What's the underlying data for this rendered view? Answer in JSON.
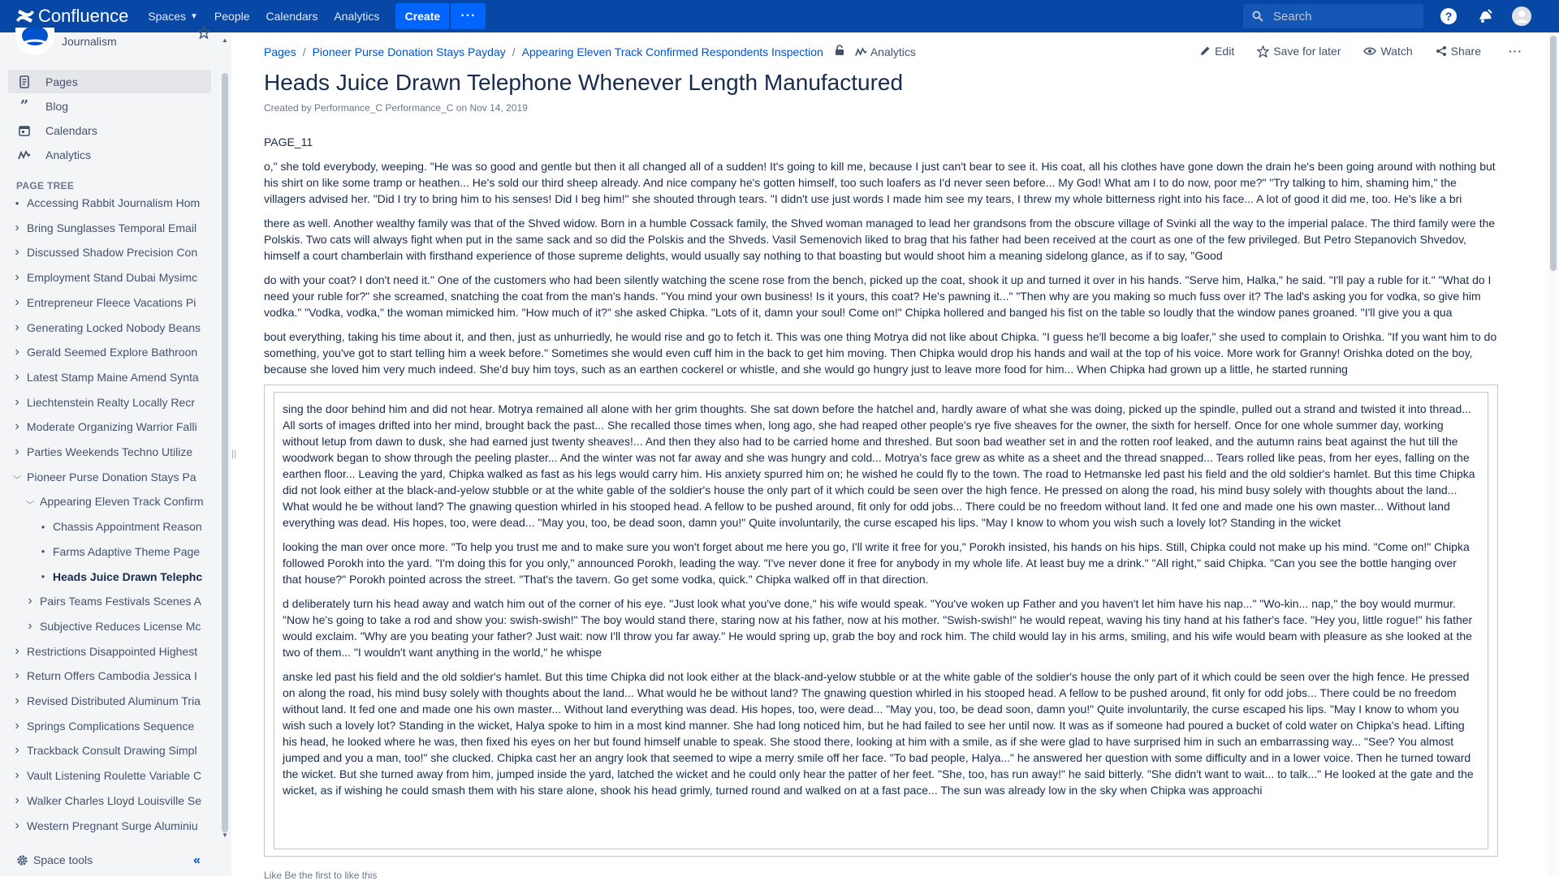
{
  "topnav": {
    "product_name": "Confluence",
    "spaces_label": "Spaces",
    "people_label": "People",
    "calendars_label": "Calendars",
    "analytics_label": "Analytics",
    "create_label": "Create",
    "more_label": "···",
    "search_placeholder": "Search"
  },
  "sidebar": {
    "space_name": "Journalism",
    "links": [
      {
        "label": "Pages",
        "icon": "pages-icon"
      },
      {
        "label": "Blog",
        "icon": "blog-quote-icon"
      },
      {
        "label": "Calendars",
        "icon": "calendar-icon"
      },
      {
        "label": "Analytics",
        "icon": "analytics-icon"
      }
    ],
    "page_tree_title": "PAGE TREE",
    "tree": [
      {
        "label": "Accessing Rabbit Journalism Hom",
        "marker": "dot"
      },
      {
        "label": "Bring Sunglasses Temporal Email",
        "marker": "chevron-right"
      },
      {
        "label": "Discussed Shadow Precision Con",
        "marker": "chevron-right"
      },
      {
        "label": "Employment Stand Dubai Mysimc",
        "marker": "chevron-right"
      },
      {
        "label": "Entrepreneur Fleece Vacations Pi",
        "marker": "chevron-right"
      },
      {
        "label": "Generating Locked Nobody Beans",
        "marker": "chevron-right"
      },
      {
        "label": "Gerald Seemed Explore Bathroon",
        "marker": "chevron-right"
      },
      {
        "label": "Latest Stamp Maine Amend Synta",
        "marker": "chevron-right"
      },
      {
        "label": "Liechtenstein Realty Locally Recr",
        "marker": "chevron-right"
      },
      {
        "label": "Moderate Organizing Warrior Falli",
        "marker": "chevron-right"
      },
      {
        "label": "Parties Weekends Techno Utilize",
        "marker": "chevron-right"
      },
      {
        "label": "Pioneer Purse Donation Stays Pa",
        "marker": "chevron-down"
      },
      {
        "label": "Appearing Eleven Track Confirm",
        "marker": "chevron-down"
      },
      {
        "label": "Chassis Appointment Reason",
        "marker": "dot"
      },
      {
        "label": "Farms Adaptive Theme Page",
        "marker": "dot"
      },
      {
        "label": "Heads Juice Drawn Telephc",
        "marker": "dot"
      },
      {
        "label": "Pairs Teams Festivals Scenes A",
        "marker": "chevron-right"
      },
      {
        "label": "Subjective Reduces License Mc",
        "marker": "chevron-right"
      },
      {
        "label": "Restrictions Disappointed Highest",
        "marker": "chevron-right"
      },
      {
        "label": "Return Offers Cambodia Jessica I",
        "marker": "chevron-right"
      },
      {
        "label": "Revised Distributed Aluminum Tria",
        "marker": "chevron-right"
      },
      {
        "label": "Springs Complications Sequence",
        "marker": "chevron-right"
      },
      {
        "label": "Trackback Consult Drawing Simpl",
        "marker": "chevron-right"
      },
      {
        "label": "Vault Listening Roulette Variable C",
        "marker": "chevron-right"
      },
      {
        "label": "Walker Charles Lloyd Louisville Se",
        "marker": "chevron-right"
      },
      {
        "label": "Western Pregnant Surge Aluminiu",
        "marker": "chevron-right"
      }
    ],
    "space_tools_label": "Space tools"
  },
  "breadcrumb": {
    "items": [
      "Pages",
      "Pioneer Purse Donation Stays Payday",
      "Appearing Eleven Track Confirmed Respondents Inspection"
    ],
    "analytics_label": "Analytics"
  },
  "actions": {
    "edit": "Edit",
    "save_for_later": "Save for later",
    "watch": "Watch",
    "share": "Share",
    "more": "···"
  },
  "page": {
    "title": "Heads Juice Drawn Telephone Whenever Length Manufactured",
    "byline": "Created by Performance_C Performance_C on Nov 14, 2019",
    "label_text": "PAGE_11",
    "paragraphs": [
      "o,\" she told everybody, weeping. \"He was so good and gentle but then it all changed all of a sudden! It's going to kill me, because I just can't bear to see it. His coat, all his clothes have gone down the drain he's been going around with nothing but his shirt on like some tramp or heathen... He's sold our third sheep already. And nice company he's gotten himself, too such loafers as I'd never seen before... My God! What am I to do now, poor me?\" \"Try talking to him, shaming him,\" the villagers advised her. \"Did I try to bring him to his senses! Did I beg him!\" she shouted through tears. \"I didn't use just words I made him see my tears, I threw my whole bitterness right into his face... A lot of good it did me, too. He's like a bri",
      "there as well. Another wealthy family was that of the Shved widow. Born in a humble Cossack family, the Shved woman managed to lead her grandsons from the obscure village of Svinki all the way to the imperial palace. The third family were the Polskis. Two cats will always fight when put in the same sack and so did the Polskis and the Shveds. Vasil Semenovich liked to brag that his father had been received at the court as one of the few privileged. But Petro Stepanovich Shvedov, himself a court chamberlain with firsthand experience of those supreme delights, would usually say nothing to that boasting but would shoot him a meaning sidelong glance, as if to say, \"Good",
      "do with your coat? I don't need it.\" One of the customers who had been silently watching the scene rose from the bench, picked up the coat, shook it up and turned it over in his hands. \"Serve him, Halka,\" he said. \"I'll pay a ruble for it.\" \"What do I need your ruble for?\" she screamed, snatching the coat from the man's hands. \"You mind your own business! Is it yours, this coat? He's pawning it...\" \"Then why are you making so much fuss over it? The lad's asking you for vodka, so give him vodka.\" \"Vodka, vodka,\" the woman mimicked him. \"How much of it?\" she asked Chipka. \"Lots of it, damn your soul! Come on!\" Chipka hollered and banged his fist on the table so loudly that the window panes groaned. \"I'll give you a qua",
      "bout everything, taking his time about it, and then, just as unhurriedly, he would rise and go to fetch it. This was one thing Motrya did not like about Chipka. \"I guess he'll become a big loafer,\" she used to complain to Orishka. \"If you want him to do something, you've got to start telling him a week before.\" Sometimes she would even cuff him in the back to get him moving. Then Chipka would drop his hands and wail at the top of his voice. More work for Granny! Orishka doted on the boy, because she loved him very much indeed. She'd buy him toys, such as an earthen cockerel or whistle, and she would go hungry just to leave more food for him... When Chipka had grown up a little, he started running"
    ],
    "boxed_paragraphs": [
      "sing the door behind him and did not hear. Motrya remained all alone with her grim thoughts. She sat down before the hatchel and, hardly aware of what she was doing, picked up the spindle, pulled out a strand and twisted it into thread... All sorts of images drifted into her mind, brought back the past... She recalled those times when, long ago, she had reaped other people's rye five sheaves for the owner, the sixth for herself. Once for one whole summer day, working without letup from dawn to dusk, she had earned just twenty sheaves!... And then they also had to be carried home and threshed. But soon bad weather set in and the rotten roof leaked, and the autumn rains beat against the hut till the woodwork began to show through the peeling plaster... And the winter was not far away and she was hungry and cold... Motrya's face grew as white as a sheet and the thread snapped... Tears rolled like peas, from her eyes, falling on the earthen floor... Leaving the yard, Chipka walked as fast as his legs would carry him. His anxiety spurred him on; he wished he could fly to the town. The road to Hetmanske led past his field and the old soldier's hamlet. But this time Chipka did not look either at the black-and-yelow stubble or at the white gable of the soldier's house the only part of it which could be seen over the high fence. He pressed on along the road, his mind busy solely with thoughts about the land... What would he be without land? The gnawing question whirled in his stooped head. A fellow to be pushed around, fit only for odd jobs... There could be no freedom without land. It fed one and made one his own master... Without land everything was dead. His hopes, too, were dead... \"May you, too, be dead soon, damn you!\" Quite involuntarily, the curse escaped his lips. \"May I know to whom you wish such a lovely lot? Standing in the wicket",
      "looking the man over once more. \"To help you trust me and to make sure you won't forget about me here you go, I'll write it free for you,\" Porokh insisted, his hands on his hips. Still, Chipka could not make up his mind. \"Come on!\" Chipka followed Porokh into the yard. \"I'm doing this for you only,\" announced Porokh, leading the way. \"I've never done it free for anybody in my whole life. At least buy me a drink.\" \"All right,\" said Chipka. \"Can you see the bottle hanging over that house?\" Porokh pointed across the street. \"That's the tavern. Go get some vodka, quick.\" Chipka walked off in that direction.",
      "d deliberately turn his head away and watch him out of the corner of his eye. \"Just look what you've done,\" his wife would speak. \"You've woken up Father and you haven't let him have his nap...\" \"Wo-kin... nap,\" the boy would murmur. \"Now he's going to take a rod and show you: swish-swish!\" The boy would stand there, staring now at his father, now at his mother. \"Swish-swish!\" he would repeat, waving his tiny hand at his father's face. \"Hey you, little rogue!\" his father would exclaim. \"Why are you beating your father? Just wait: now I'll throw you far away.\" He would spring up, grab the boy and rock him. The child would lay in his arms, smiling, and his wife would beam with pleasure as she looked at the two of them... \"I wouldn't want anything in the world,\" he whispe",
      "anske led past his field and the old soldier's hamlet. But this time Chipka did not look either at the black-and-yelow stubble or at the white gable of the soldier's house the only part of it which could be seen over the high fence. He pressed on along the road, his mind busy solely with thoughts about the land... What would he be without land? The gnawing question whirled in his stooped head. A fellow to be pushed around, fit only for odd jobs... There could be no freedom without land. It fed one and made one his own master... Without land everything was dead. His hopes, too, were dead... \"May you, too, be dead soon, damn you!\" Quite involuntarily, the curse escaped his lips. \"May I know to whom you wish such a lovely lot? Standing in the wicket, Halya spoke to him in a most kind manner. She had long noticed him, but he had failed to see her until now. It was as if someone had poured a bucket of cold water on Chipka's head. Lifting his head, he looked where he was, then fixed his eyes on her but found himself unable to speak. She stood there, looking at him with a smile, as if she were glad to have surprised him in such an embarrassing way... \"See? You almost jumped and you a man, too!\" she clucked. Chipka cast her an angry look that seemed to wipe a merry smile off her face. \"To bad people, Halya...\" he answered her question with some difficulty and in a lower voice. Then he turned toward the wicket. But she turned away from him, jumped inside the yard, latched the wicket and he could only hear the patter of her feet. \"She, too, has run away!\" he said bitterly. \"She didn't want to wait... to talk...\" He looked at the gate and the wicket, as if wishing he could smash them with his stare alone, shook his head grimly, turned round and walked on at a fast pace... The sun was already low in the sky when Chipka was approachi"
    ],
    "footer_text": "Like  Be the first to like this"
  },
  "colors": {
    "topnav_bg": "#0747a6",
    "create_button_bg": "#0065ff",
    "link": "#0052cc",
    "sidebar_bg": "#f4f5f7"
  }
}
